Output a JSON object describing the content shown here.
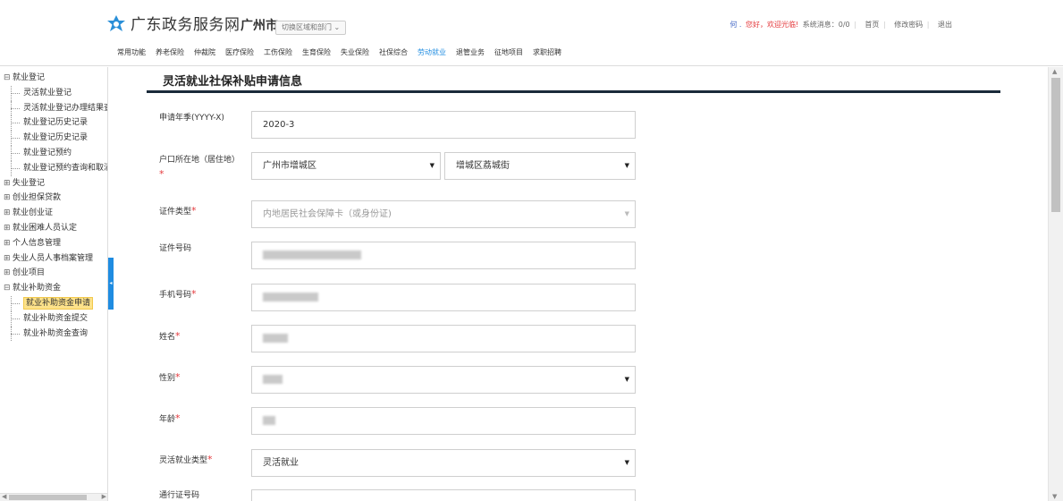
{
  "header": {
    "site_title": "广东政务服务网",
    "city": "广州市",
    "switch_label": "切换区域和部门 ⌄",
    "user_name": "何 .",
    "welcome": "您好，欢迎光临!",
    "messages": "系统消息：0/0",
    "home": "首页",
    "change_password": "修改密码",
    "logout": "退出",
    "brand_color": "#1f8ce1"
  },
  "nav": {
    "items": [
      "常用功能",
      "养老保险",
      "仲裁院",
      "医疗保险",
      "工伤保险",
      "生育保险",
      "失业保险",
      "社保综合",
      "劳动就业",
      "退管业务",
      "征地项目",
      "求职招聘"
    ],
    "active_index": 8
  },
  "sidebar": {
    "tree": [
      {
        "type": "node",
        "toggle": "⊟",
        "label": "就业登记"
      },
      {
        "type": "child",
        "label": "灵活就业登记"
      },
      {
        "type": "child",
        "label": "灵活就业登记办理结果查询"
      },
      {
        "type": "child",
        "label": "就业登记历史记录"
      },
      {
        "type": "child",
        "label": "就业登记历史记录"
      },
      {
        "type": "child",
        "label": "就业登记预约"
      },
      {
        "type": "child",
        "label": "就业登记预约查询和取消"
      },
      {
        "type": "node",
        "toggle": "⊞",
        "label": "失业登记"
      },
      {
        "type": "node",
        "toggle": "⊞",
        "label": "创业担保贷款"
      },
      {
        "type": "node",
        "toggle": "⊞",
        "label": "就业创业证"
      },
      {
        "type": "node",
        "toggle": "⊞",
        "label": "就业困难人员认定"
      },
      {
        "type": "node",
        "toggle": "⊞",
        "label": "个人信息管理"
      },
      {
        "type": "node",
        "toggle": "⊞",
        "label": "失业人员人事档案管理"
      },
      {
        "type": "node",
        "toggle": "⊞",
        "label": "创业项目"
      },
      {
        "type": "node",
        "toggle": "⊟",
        "label": "就业补助资金"
      },
      {
        "type": "child",
        "label": "就业补助资金申请",
        "selected": true
      },
      {
        "type": "child",
        "label": "就业补助资金提交"
      },
      {
        "type": "child",
        "label": "就业补助资金查询"
      }
    ]
  },
  "form": {
    "title": "灵活就业社保补贴申请信息",
    "apply_quarter": {
      "label": "申请年季(YYYY-X)",
      "value": "2020-3"
    },
    "household": {
      "label": "户口所在地（居住地）",
      "city": "广州市增城区",
      "street": "增城区荔城街"
    },
    "id_type": {
      "label": "证件类型",
      "value": "内地居民社会保障卡（或身份证)"
    },
    "id_number": {
      "label": "证件号码"
    },
    "phone": {
      "label": "手机号码"
    },
    "name": {
      "label": "姓名"
    },
    "gender": {
      "label": "性别"
    },
    "age": {
      "label": "年龄"
    },
    "employment_type": {
      "label": "灵活就业类型",
      "value": "灵活就业"
    },
    "pass_number": {
      "label": "通行证号码"
    }
  }
}
